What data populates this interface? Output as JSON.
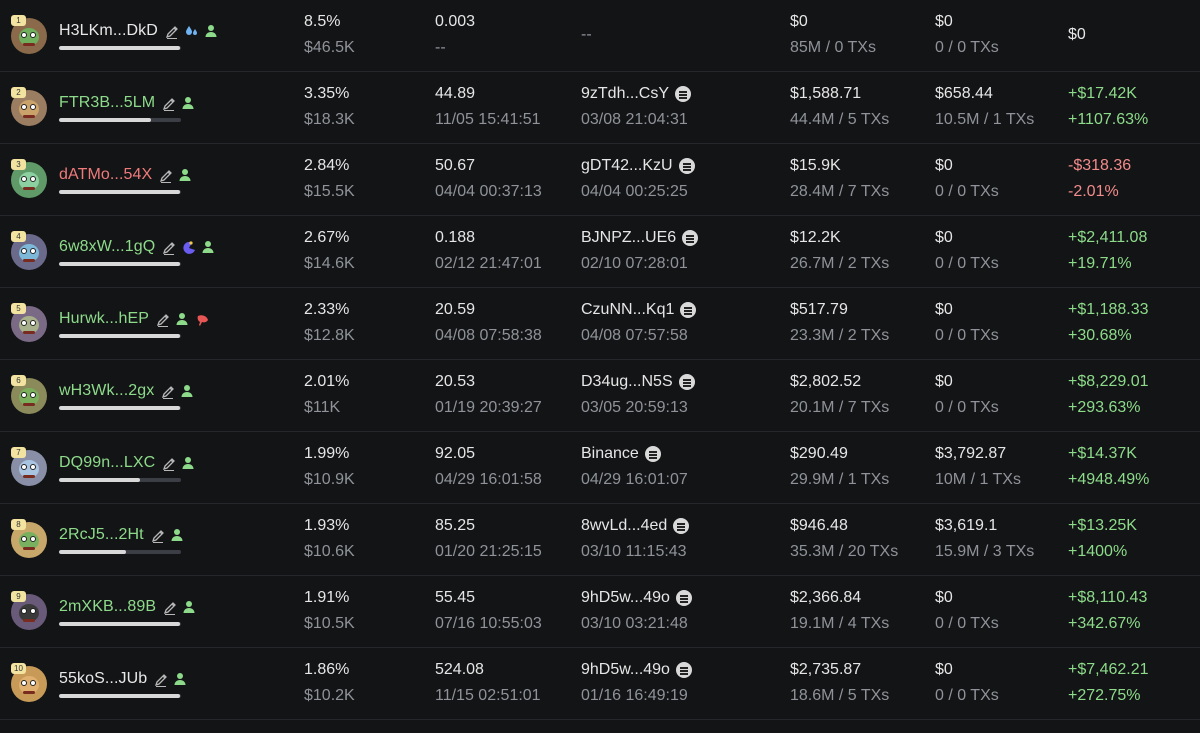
{
  "rows": [
    {
      "rank": "1",
      "address": "H3LKm...DkD",
      "addr_color": "white",
      "badges": [
        "drop-icon",
        "user-icon"
      ],
      "bar": 0.99,
      "pct": "8.5%",
      "value": "$46.5K",
      "balance": "0.003",
      "balance_time": "--",
      "source": "--",
      "source_time": "",
      "source_icon": false,
      "bought": "$0",
      "bought_sub": "85M / 0 TXs",
      "sold": "$0",
      "sold_sub": "0 / 0 TXs",
      "pnl": "$0",
      "pnl_pct": "",
      "pnl_color": "white",
      "avatar_bg": "#8a6a4a",
      "face": "#6fae5c"
    },
    {
      "rank": "2",
      "address": "FTR3B...5LM",
      "addr_color": "green",
      "badges": [
        "user-icon"
      ],
      "bar": 0.75,
      "pct": "3.35%",
      "value": "$18.3K",
      "balance": "44.89",
      "balance_time": "11/05 15:41:51",
      "source": "9zTdh...CsY",
      "source_time": "03/08 21:04:31",
      "source_icon": true,
      "bought": "$1,588.71",
      "bought_sub": "44.4M / 5 TXs",
      "sold": "$658.44",
      "sold_sub": "10.5M / 1 TXs",
      "pnl": "+$17.42K",
      "pnl_pct": "+1107.63%",
      "pnl_color": "green",
      "avatar_bg": "#9b7d62",
      "face": "#caa36a"
    },
    {
      "rank": "3",
      "address": "dATMo...54X",
      "addr_color": "red",
      "badges": [
        "user-icon"
      ],
      "bar": 0.99,
      "pct": "2.84%",
      "value": "$15.5K",
      "balance": "50.67",
      "balance_time": "04/04 00:37:13",
      "source": "gDT42...KzU",
      "source_time": "04/04 00:25:25",
      "source_icon": true,
      "bought": "$15.9K",
      "bought_sub": "28.4M / 7 TXs",
      "sold": "$0",
      "sold_sub": "0 / 0 TXs",
      "pnl": "-$318.36",
      "pnl_pct": "-2.01%",
      "pnl_color": "red",
      "avatar_bg": "#5f9a68",
      "face": "#8ccfa0"
    },
    {
      "rank": "4",
      "address": "6w8xW...1gQ",
      "addr_color": "green",
      "badges": [
        "pac-icon",
        "user-icon"
      ],
      "bar": 0.99,
      "pct": "2.67%",
      "value": "$14.6K",
      "balance": "0.188",
      "balance_time": "02/12 21:47:01",
      "source": "BJNPZ...UE6",
      "source_time": "02/10 07:28:01",
      "source_icon": true,
      "bought": "$12.2K",
      "bought_sub": "26.7M / 2 TXs",
      "sold": "$0",
      "sold_sub": "0 / 0 TXs",
      "pnl": "+$2,411.08",
      "pnl_pct": "+19.71%",
      "pnl_color": "green",
      "avatar_bg": "#6c6a8a",
      "face": "#7db8d8"
    },
    {
      "rank": "5",
      "address": "Hurwk...hEP",
      "addr_color": "green",
      "badges": [
        "user-icon",
        "shrimp-icon"
      ],
      "bar": 0.99,
      "pct": "2.33%",
      "value": "$12.8K",
      "balance": "20.59",
      "balance_time": "04/08 07:58:38",
      "source": "CzuNN...Kq1",
      "source_time": "04/08 07:57:58",
      "source_icon": true,
      "bought": "$517.79",
      "bought_sub": "23.3M / 2 TXs",
      "sold": "$0",
      "sold_sub": "0 / 0 TXs",
      "pnl": "+$1,188.33",
      "pnl_pct": "+30.68%",
      "pnl_color": "green",
      "avatar_bg": "#7b6a86",
      "face": "#a6b08a"
    },
    {
      "rank": "6",
      "address": "wH3Wk...2gx",
      "addr_color": "green",
      "badges": [
        "user-icon"
      ],
      "bar": 0.99,
      "pct": "2.01%",
      "value": "$11K",
      "balance": "20.53",
      "balance_time": "01/19 20:39:27",
      "source": "D34ug...N5S",
      "source_time": "03/05 20:59:13",
      "source_icon": true,
      "bought": "$2,802.52",
      "bought_sub": "20.1M / 7 TXs",
      "sold": "$0",
      "sold_sub": "0 / 0 TXs",
      "pnl": "+$8,229.01",
      "pnl_pct": "+293.63%",
      "pnl_color": "green",
      "avatar_bg": "#8a8a5a",
      "face": "#7ab05c"
    },
    {
      "rank": "7",
      "address": "DQ99n...LXC",
      "addr_color": "green",
      "badges": [
        "user-icon"
      ],
      "bar": 0.66,
      "pct": "1.99%",
      "value": "$10.9K",
      "balance": "92.05",
      "balance_time": "04/29 16:01:58",
      "source": "Binance",
      "source_time": "04/29 16:01:07",
      "source_icon": true,
      "bought": "$290.49",
      "bought_sub": "29.9M / 1 TXs",
      "sold": "$3,792.87",
      "sold_sub": "10M / 1 TXs",
      "pnl": "+$14.37K",
      "pnl_pct": "+4948.49%",
      "pnl_color": "green",
      "avatar_bg": "#8a8fa8",
      "face": "#a8c4e0"
    },
    {
      "rank": "8",
      "address": "2RcJ5...2Ht",
      "addr_color": "green",
      "badges": [
        "user-icon"
      ],
      "bar": 0.55,
      "pct": "1.93%",
      "value": "$10.6K",
      "balance": "85.25",
      "balance_time": "01/20 21:25:15",
      "source": "8wvLd...4ed",
      "source_time": "03/10 11:15:43",
      "source_icon": true,
      "bought": "$946.48",
      "bought_sub": "35.3M / 20 TXs",
      "sold": "$3,619.1",
      "sold_sub": "15.9M / 3 TXs",
      "pnl": "+$13.25K",
      "pnl_pct": "+1400%",
      "pnl_color": "green",
      "avatar_bg": "#c8a86a",
      "face": "#78b060"
    },
    {
      "rank": "9",
      "address": "2mXKB...89B",
      "addr_color": "green",
      "badges": [
        "user-icon"
      ],
      "bar": 0.99,
      "pct": "1.91%",
      "value": "$10.5K",
      "balance": "55.45",
      "balance_time": "07/16 10:55:03",
      "source": "9hD5w...49o",
      "source_time": "03/10 03:21:48",
      "source_icon": true,
      "bought": "$2,366.84",
      "bought_sub": "19.1M / 4 TXs",
      "sold": "$0",
      "sold_sub": "0 / 0 TXs",
      "pnl": "+$8,110.43",
      "pnl_pct": "+342.67%",
      "pnl_color": "green",
      "avatar_bg": "#6a5a7a",
      "face": "#3a3a3a"
    },
    {
      "rank": "10",
      "address": "55koS...JUb",
      "addr_color": "white",
      "badges": [
        "user-icon"
      ],
      "bar": 0.99,
      "pct": "1.86%",
      "value": "$10.2K",
      "balance": "524.08",
      "balance_time": "11/15 02:51:01",
      "source": "9hD5w...49o",
      "source_time": "01/16 16:49:19",
      "source_icon": true,
      "bought": "$2,735.87",
      "bought_sub": "18.6M / 5 TXs",
      "sold": "$0",
      "sold_sub": "0 / 0 TXs",
      "pnl": "+$7,462.21",
      "pnl_pct": "+272.75%",
      "pnl_color": "green",
      "avatar_bg": "#c89a58",
      "face": "#e0b070"
    }
  ]
}
